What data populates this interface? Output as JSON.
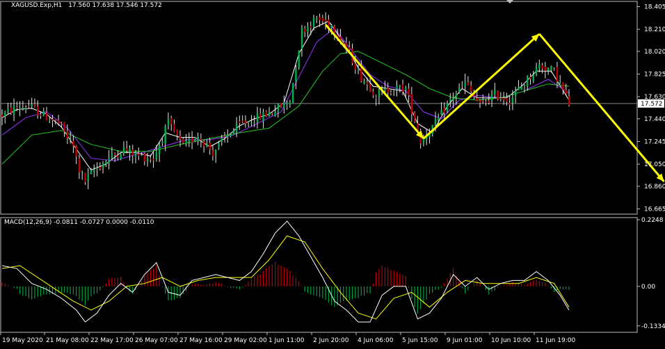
{
  "chart_data": [
    {
      "type": "candlestick",
      "header": {
        "symbol": "XAGUSD.Exp,H1",
        "open": "17.560",
        "high": "17.638",
        "low": "17.546",
        "close": "17.572"
      },
      "ylim": [
        16.62,
        18.45
      ],
      "y_ticks": [
        "18.405",
        "18.210",
        "18.020",
        "17.825",
        "17.630",
        "17.440",
        "17.245",
        "17.050",
        "16.860",
        "16.665"
      ],
      "current_price": "17.572",
      "x_labels": [
        "19 May 2020",
        "21 May 08:00",
        "22 May 17:00",
        "26 May 07:00",
        "27 May 16:00",
        "29 May 02:00",
        "1 Jun 11:00",
        "2 Jun 20:00",
        "4 Jun 06:00",
        "5 Jun 15:00",
        "9 Jun 01:00",
        "10 Jun 10:00",
        "11 Jun 19:00"
      ],
      "bar_count": 192,
      "close_path": [
        [
          0,
          17.47
        ],
        [
          4,
          17.53
        ],
        [
          9,
          17.55
        ],
        [
          14,
          17.47
        ],
        [
          19,
          17.4
        ],
        [
          24,
          17.2
        ],
        [
          26,
          17.0
        ],
        [
          28,
          16.9
        ],
        [
          31,
          17.0
        ],
        [
          36,
          17.1
        ],
        [
          41,
          17.18
        ],
        [
          46,
          17.12
        ],
        [
          51,
          17.1
        ],
        [
          56,
          17.4
        ],
        [
          61,
          17.2
        ],
        [
          66,
          17.3
        ],
        [
          71,
          17.15
        ],
        [
          76,
          17.3
        ],
        [
          81,
          17.4
        ],
        [
          86,
          17.45
        ],
        [
          91,
          17.5
        ],
        [
          97,
          17.6
        ],
        [
          101,
          18.2
        ],
        [
          106,
          18.3
        ],
        [
          111,
          18.25
        ],
        [
          116,
          18.05
        ],
        [
          121,
          17.8
        ],
        [
          126,
          17.65
        ],
        [
          131,
          17.7
        ],
        [
          136,
          17.7
        ],
        [
          141,
          17.25
        ],
        [
          146,
          17.4
        ],
        [
          151,
          17.6
        ],
        [
          156,
          17.75
        ],
        [
          161,
          17.55
        ],
        [
          166,
          17.65
        ],
        [
          171,
          17.6
        ],
        [
          176,
          17.75
        ],
        [
          181,
          17.9
        ],
        [
          186,
          17.85
        ],
        [
          191,
          17.57
        ]
      ],
      "moving_averages": [
        {
          "color": "#ffffff",
          "path": [
            [
              0,
              17.45
            ],
            [
              5,
              17.52
            ],
            [
              10,
              17.53
            ],
            [
              15,
              17.48
            ],
            [
              20,
              17.37
            ],
            [
              25,
              17.18
            ],
            [
              30,
              17.0
            ],
            [
              35,
              17.05
            ],
            [
              40,
              17.15
            ],
            [
              45,
              17.15
            ],
            [
              50,
              17.12
            ],
            [
              55,
              17.32
            ],
            [
              60,
              17.28
            ],
            [
              65,
              17.28
            ],
            [
              70,
              17.2
            ],
            [
              75,
              17.27
            ],
            [
              80,
              17.38
            ],
            [
              85,
              17.44
            ],
            [
              90,
              17.48
            ],
            [
              95,
              17.58
            ],
            [
              100,
              18.0
            ],
            [
              105,
              18.22
            ],
            [
              110,
              18.28
            ],
            [
              115,
              18.1
            ],
            [
              120,
              17.88
            ],
            [
              125,
              17.72
            ],
            [
              130,
              17.7
            ],
            [
              135,
              17.68
            ],
            [
              140,
              17.4
            ],
            [
              145,
              17.32
            ],
            [
              150,
              17.55
            ],
            [
              155,
              17.7
            ],
            [
              160,
              17.62
            ],
            [
              165,
              17.62
            ],
            [
              170,
              17.62
            ],
            [
              175,
              17.72
            ],
            [
              180,
              17.85
            ],
            [
              185,
              17.85
            ],
            [
              191,
              17.6
            ]
          ]
        },
        {
          "color": "#9933ff",
          "path": [
            [
              0,
              17.3
            ],
            [
              8,
              17.45
            ],
            [
              15,
              17.5
            ],
            [
              22,
              17.36
            ],
            [
              30,
              17.1
            ],
            [
              38,
              17.08
            ],
            [
              46,
              17.14
            ],
            [
              54,
              17.2
            ],
            [
              62,
              17.26
            ],
            [
              70,
              17.26
            ],
            [
              78,
              17.3
            ],
            [
              86,
              17.4
            ],
            [
              94,
              17.5
            ],
            [
              100,
              17.8
            ],
            [
              106,
              18.1
            ],
            [
              112,
              18.22
            ],
            [
              118,
              18.02
            ],
            [
              124,
              17.82
            ],
            [
              130,
              17.72
            ],
            [
              136,
              17.68
            ],
            [
              142,
              17.5
            ],
            [
              148,
              17.44
            ],
            [
              154,
              17.6
            ],
            [
              160,
              17.64
            ],
            [
              168,
              17.62
            ],
            [
              176,
              17.68
            ],
            [
              184,
              17.78
            ],
            [
              191,
              17.66
            ]
          ]
        },
        {
          "color": "#22cc22",
          "path": [
            [
              0,
              17.05
            ],
            [
              10,
              17.3
            ],
            [
              20,
              17.34
            ],
            [
              30,
              17.22
            ],
            [
              40,
              17.16
            ],
            [
              50,
              17.16
            ],
            [
              60,
              17.22
            ],
            [
              70,
              17.27
            ],
            [
              80,
              17.32
            ],
            [
              90,
              17.36
            ],
            [
              100,
              17.55
            ],
            [
              108,
              17.85
            ],
            [
              114,
              18.0
            ],
            [
              120,
              18.02
            ],
            [
              128,
              17.92
            ],
            [
              136,
              17.82
            ],
            [
              144,
              17.7
            ],
            [
              152,
              17.62
            ],
            [
              160,
              17.6
            ],
            [
              168,
              17.62
            ],
            [
              176,
              17.68
            ],
            [
              184,
              17.74
            ],
            [
              191,
              17.72
            ]
          ]
        }
      ],
      "annotations": [
        {
          "type": "arrow",
          "color": "#ffff00",
          "from": [
            109,
            18.25
          ],
          "to": [
            142,
            17.27
          ]
        },
        {
          "type": "arrow",
          "color": "#ffff00",
          "from": [
            142,
            17.27
          ],
          "to": [
            181,
            18.17
          ]
        },
        {
          "type": "arrow",
          "color": "#ffff00",
          "from": [
            181,
            18.17
          ],
          "to": [
            223,
            16.9
          ]
        }
      ],
      "candle_colors": {
        "up": "#00b050",
        "down": "#c00000"
      }
    },
    {
      "type": "histogram_line",
      "label": "MACD(12,26,9) -0.0811 -0.0727 0.0000 -0.0110",
      "ylim": [
        -0.155,
        0.232
      ],
      "y_ticks": [
        "0.2248",
        "0.00",
        "-0.1334"
      ],
      "macd_path": [
        [
          0,
          0.07
        ],
        [
          5,
          0.06
        ],
        [
          10,
          0.01
        ],
        [
          15,
          -0.01
        ],
        [
          20,
          -0.04
        ],
        [
          25,
          -0.08
        ],
        [
          28,
          -0.12
        ],
        [
          32,
          -0.09
        ],
        [
          36,
          -0.03
        ],
        [
          40,
          0.01
        ],
        [
          44,
          -0.02
        ],
        [
          48,
          0.04
        ],
        [
          52,
          0.08
        ],
        [
          56,
          -0.02
        ],
        [
          60,
          -0.03
        ],
        [
          64,
          0.02
        ],
        [
          68,
          0.03
        ],
        [
          72,
          0.04
        ],
        [
          76,
          0.03
        ],
        [
          80,
          0.02
        ],
        [
          84,
          0.05
        ],
        [
          88,
          0.11
        ],
        [
          92,
          0.18
        ],
        [
          96,
          0.22
        ],
        [
          100,
          0.17
        ],
        [
          104,
          0.1
        ],
        [
          108,
          0.03
        ],
        [
          112,
          -0.05
        ],
        [
          116,
          -0.08
        ],
        [
          120,
          -0.12
        ],
        [
          124,
          -0.12
        ],
        [
          128,
          -0.03
        ],
        [
          132,
          0.0
        ],
        [
          136,
          0.0
        ],
        [
          140,
          -0.11
        ],
        [
          144,
          -0.09
        ],
        [
          148,
          -0.04
        ],
        [
          152,
          0.04
        ],
        [
          156,
          0.0
        ],
        [
          160,
          0.03
        ],
        [
          164,
          -0.01
        ],
        [
          168,
          0.01
        ],
        [
          172,
          0.02
        ],
        [
          176,
          0.02
        ],
        [
          180,
          0.05
        ],
        [
          184,
          0.02
        ],
        [
          188,
          -0.03
        ],
        [
          191,
          -0.08
        ]
      ],
      "signal_path": [
        [
          0,
          0.06
        ],
        [
          6,
          0.07
        ],
        [
          12,
          0.03
        ],
        [
          18,
          -0.01
        ],
        [
          24,
          -0.05
        ],
        [
          30,
          -0.08
        ],
        [
          36,
          -0.05
        ],
        [
          42,
          0.0
        ],
        [
          48,
          0.01
        ],
        [
          54,
          0.03
        ],
        [
          60,
          0.0
        ],
        [
          66,
          0.02
        ],
        [
          72,
          0.03
        ],
        [
          78,
          0.03
        ],
        [
          84,
          0.03
        ],
        [
          90,
          0.09
        ],
        [
          96,
          0.17
        ],
        [
          102,
          0.15
        ],
        [
          108,
          0.06
        ],
        [
          114,
          -0.02
        ],
        [
          120,
          -0.09
        ],
        [
          126,
          -0.11
        ],
        [
          132,
          -0.04
        ],
        [
          138,
          -0.02
        ],
        [
          144,
          -0.07
        ],
        [
          150,
          -0.02
        ],
        [
          156,
          0.02
        ],
        [
          162,
          0.01
        ],
        [
          168,
          0.01
        ],
        [
          174,
          0.01
        ],
        [
          180,
          0.03
        ],
        [
          186,
          0.01
        ],
        [
          191,
          -0.07
        ]
      ],
      "hist_colors": {
        "positive": "#c00000",
        "negative": "#00a040"
      },
      "line_colors": {
        "macd": "#ffffff",
        "signal": "#ffff00"
      }
    }
  ]
}
